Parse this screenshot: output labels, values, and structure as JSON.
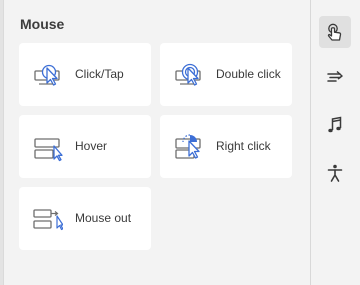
{
  "section": {
    "title": "Mouse"
  },
  "triggers": [
    {
      "label": "Click/Tap",
      "icon": "click-tap-icon"
    },
    {
      "label": "Double click",
      "icon": "double-click-icon"
    },
    {
      "label": "Hover",
      "icon": "hover-icon"
    },
    {
      "label": "Right click",
      "icon": "right-click-icon"
    },
    {
      "label": "Mouse out",
      "icon": "mouse-out-icon"
    }
  ],
  "rail": [
    {
      "icon": "touch-icon",
      "active": true
    },
    {
      "icon": "fast-forward-icon",
      "active": false
    },
    {
      "icon": "music-note-icon",
      "active": false
    },
    {
      "icon": "accessibility-icon",
      "active": false
    }
  ],
  "colors": {
    "accent": "#3d6fd6",
    "icon_gray": "#6e6e6e",
    "card": "#ffffff",
    "panel": "#f3f3f3"
  }
}
